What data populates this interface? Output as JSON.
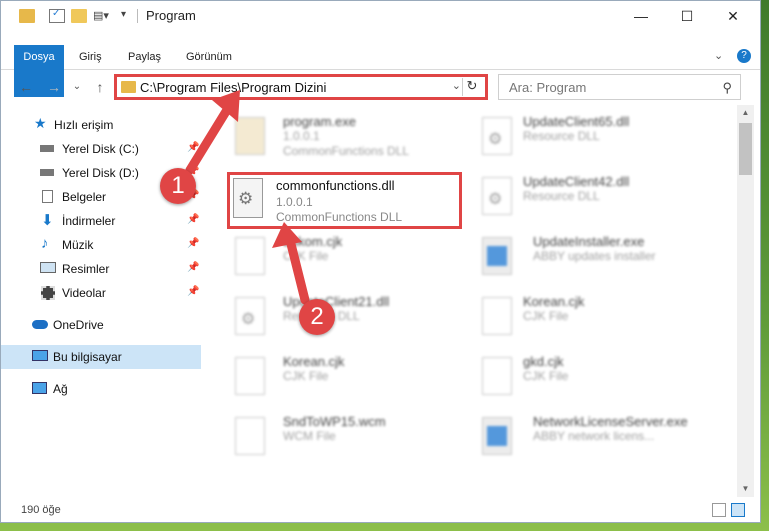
{
  "window": {
    "title": "Program"
  },
  "ribbon": {
    "tabs": [
      {
        "label": "Dosya"
      },
      {
        "label": "Giriş"
      },
      {
        "label": "Paylaş"
      },
      {
        "label": "Görünüm"
      }
    ],
    "help": "?"
  },
  "navbar": {
    "address": "C:\\Program Files\\Program Dizini",
    "search_placeholder": "Ara: Program"
  },
  "sidebar": {
    "items": [
      {
        "label": "Hızlı erişim"
      },
      {
        "label": "Yerel Disk (C:)"
      },
      {
        "label": "Yerel Disk (D:)"
      },
      {
        "label": "Belgeler"
      },
      {
        "label": "İndirmeler"
      },
      {
        "label": "Müzik"
      },
      {
        "label": "Resimler"
      },
      {
        "label": "Videolar"
      },
      {
        "label": "OneDrive"
      },
      {
        "label": "Bu bilgisayar"
      },
      {
        "label": "Ağ"
      }
    ]
  },
  "files": [
    {
      "name": "program.exe",
      "line2": "1.0.0.1",
      "line3": "CommonFunctions DLL"
    },
    {
      "name": "UpdateClient65.dll",
      "line2": "Resource DLL"
    },
    {
      "name": "commonfunctions.dll",
      "line2": "1.0.0.1",
      "line3": "CommonFunctions DLL"
    },
    {
      "name": "UpdateClient42.dll",
      "line2": "Resource DLL"
    },
    {
      "name": "Eskom.cjk",
      "line2": "CJK File"
    },
    {
      "name": "UpdateInstaller.exe",
      "line2": "ABBY updates installer"
    },
    {
      "name": "UpdateClient21.dll",
      "line2": "Resource DLL"
    },
    {
      "name": "Korean.cjk",
      "line2": "CJK File"
    },
    {
      "name": "Korean.cjk",
      "line2": "CJK File"
    },
    {
      "name": "gkd.cjk",
      "line2": "CJK File"
    },
    {
      "name": "SndToWP15.wcm",
      "line2": "WCM File"
    },
    {
      "name": "NetworkLicenseServer.exe",
      "line2": "ABBY network licens..."
    }
  ],
  "status": {
    "count": "190 öğe"
  },
  "callouts": {
    "one": "1",
    "two": "2"
  },
  "colors": {
    "accent": "#1979ca",
    "highlight": "#e04545",
    "selected": "#cce4f7"
  }
}
